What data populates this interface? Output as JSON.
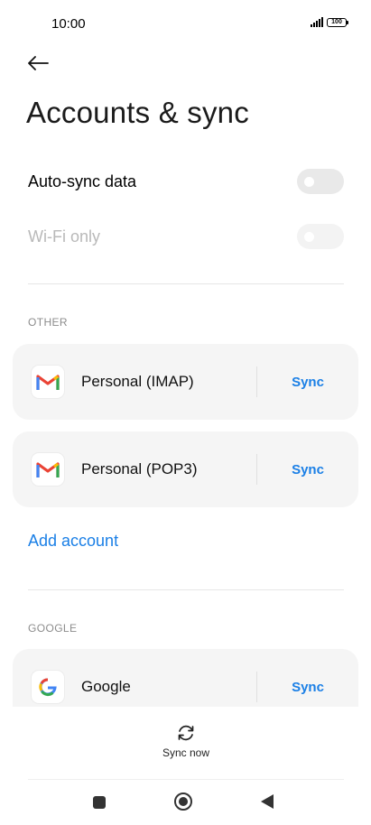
{
  "status_bar": {
    "time": "10:00",
    "battery": "100"
  },
  "header": {
    "title": "Accounts & sync"
  },
  "settings": {
    "auto_sync": {
      "label": "Auto-sync data",
      "enabled": false
    },
    "wifi_only": {
      "label": "Wi-Fi only",
      "enabled": false
    }
  },
  "sections": {
    "other": {
      "header": "OTHER",
      "accounts": [
        {
          "name": "Personal (IMAP)",
          "icon": "gmail-icon",
          "action": "Sync"
        },
        {
          "name": "Personal (POP3)",
          "icon": "gmail-icon",
          "action": "Sync"
        }
      ],
      "add_account": "Add account"
    },
    "google": {
      "header": "GOOGLE",
      "accounts": [
        {
          "name": "Google",
          "icon": "google-icon",
          "action": "Sync"
        }
      ]
    }
  },
  "bottom": {
    "sync_now": "Sync now"
  },
  "colors": {
    "accent": "#1a7fe6",
    "card_bg": "#f5f5f5",
    "muted_text": "#b9b9b9"
  }
}
